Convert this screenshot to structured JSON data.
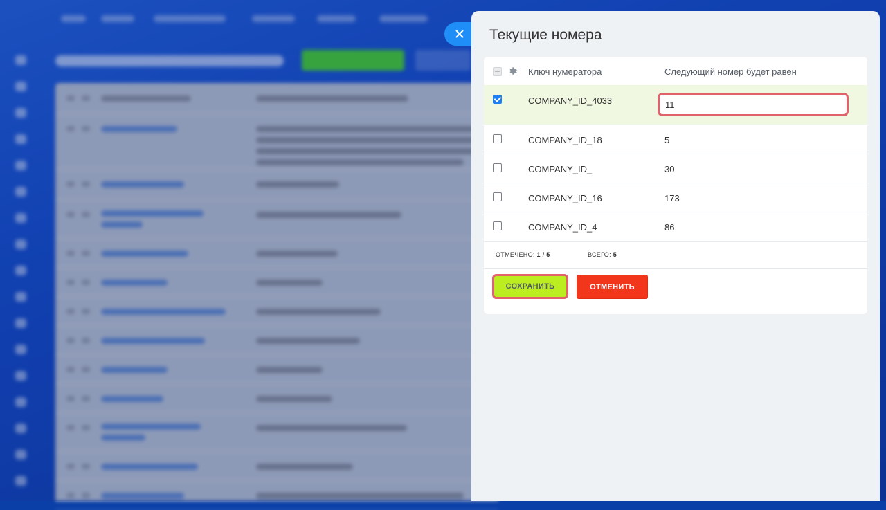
{
  "panel": {
    "title": "Текущие номера",
    "close_icon": "close-icon"
  },
  "table": {
    "columns": {
      "key": "Ключ нумератора",
      "next": "Следующий номер будет равен"
    },
    "settings_icon": "gear-icon",
    "rows": [
      {
        "key": "COMPANY_ID_4033",
        "value": "11",
        "checked": true,
        "editing": true
      },
      {
        "key": "COMPANY_ID_18",
        "value": "5",
        "checked": false
      },
      {
        "key": "COMPANY_ID_",
        "value": "30",
        "checked": false
      },
      {
        "key": "COMPANY_ID_16",
        "value": "173",
        "checked": false
      },
      {
        "key": "COMPANY_ID_4",
        "value": "86",
        "checked": false
      }
    ],
    "stats": {
      "selected_label": "ОТМЕЧЕНО:",
      "selected_value": "1 / 5",
      "total_label": "ВСЕГО:",
      "total_value": "5"
    }
  },
  "actions": {
    "save_label": "СОХРАНИТЬ",
    "cancel_label": "ОТМЕНИТЬ"
  },
  "colors": {
    "accent_blue": "#1f8ef7",
    "save_green": "#bbed21",
    "cancel_red": "#f1361b",
    "highlight_red": "#e0626a",
    "selected_row": "#f1f8e1"
  }
}
